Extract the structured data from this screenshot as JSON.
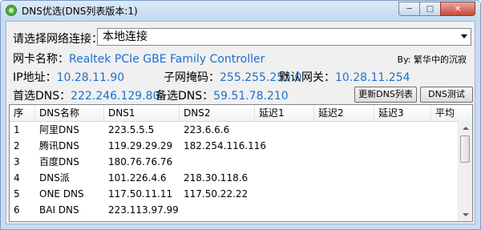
{
  "window": {
    "title": "DNS优选(DNS列表版本:1)",
    "minimize_glyph": "─",
    "maximize_glyph": "□",
    "close_glyph": "✕"
  },
  "network": {
    "select_label": "请选择网络连接：",
    "selected_value": "本地连接"
  },
  "adapter": {
    "label": "网卡名称：",
    "value": "Realtek PCIe GBE Family Controller"
  },
  "byline": "By: 繁华中的沉寂",
  "ip": {
    "ip_label": "IP地址：",
    "ip_value": "10.28.11.90",
    "mask_label": "子网掩码：",
    "mask_value": "255.255.255.0",
    "gateway_label": "默认网关：",
    "gateway_value": "10.28.11.254"
  },
  "dns": {
    "preferred_label": "首选DNS：",
    "preferred_value": "222.246.129.80",
    "alternate_label": "备选DNS：",
    "alternate_value": "59.51.78.210"
  },
  "buttons": {
    "update_list": "更新DNS列表",
    "dns_test": "DNS测试"
  },
  "table": {
    "columns": [
      "序",
      "DNS名称",
      "DNS1",
      "DNS2",
      "延迟1",
      "延迟2",
      "延迟3",
      "平均"
    ],
    "rows": [
      [
        "1",
        "阿里DNS",
        "223.5.5.5",
        "223.6.6.6",
        "",
        "",
        "",
        ""
      ],
      [
        "2",
        "腾讯DNS",
        "119.29.29.29",
        "182.254.116.116",
        "",
        "",
        "",
        ""
      ],
      [
        "3",
        "百度DNS",
        "180.76.76.76",
        "",
        "",
        "",
        "",
        ""
      ],
      [
        "4",
        "DNS派",
        "101.226.4.6",
        "218.30.118.6",
        "",
        "",
        "",
        ""
      ],
      [
        "5",
        "ONE DNS",
        "117.50.11.11",
        "117.50.22.22",
        "",
        "",
        "",
        ""
      ],
      [
        "6",
        "BAI DNS",
        "223.113.97.99",
        "",
        "",
        "",
        "",
        ""
      ]
    ]
  },
  "colors": {
    "value_text": "#1e6fd0",
    "window_frame": "#c9dcf3"
  }
}
